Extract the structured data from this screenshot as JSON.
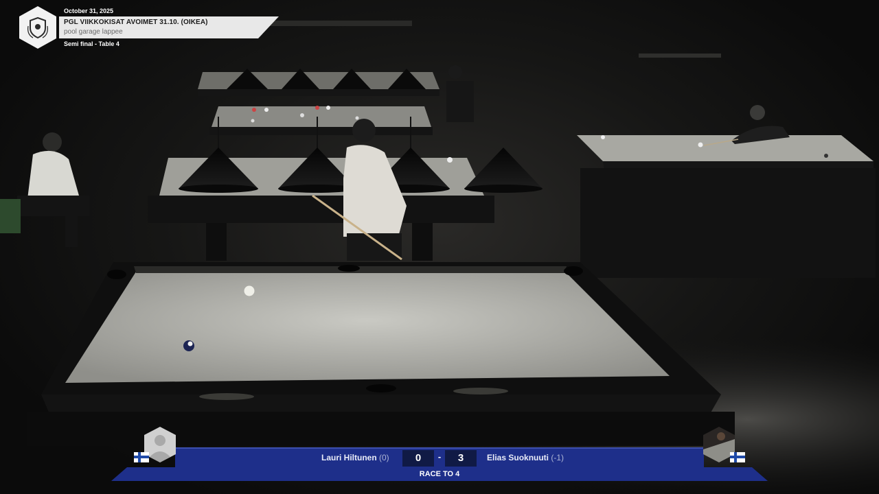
{
  "header": {
    "date": "October 31, 2025",
    "title": "PGL VIIKKOKISAT AVOIMET 31.10. (OIKEA)",
    "venue": "pool garage lappee",
    "round": "Semi final - Table 4"
  },
  "scoreboard": {
    "player_left": {
      "name": "Lauri Hiltunen",
      "handicap": "(0)",
      "score": "0",
      "flag": "finland-flag-icon"
    },
    "player_right": {
      "name": "Elias Suoknuuti",
      "handicap": "(-1)",
      "score": "3",
      "flag": "finland-flag-icon"
    },
    "separator": "-",
    "race": "RACE TO 4"
  },
  "colors": {
    "scoreboard_blue": "#1e2f8a",
    "scoreboard_dark": "#101a45",
    "felt": "#b9b9b3",
    "table_rail": "#1b1b1b",
    "header_band": "#e8e8e8"
  }
}
